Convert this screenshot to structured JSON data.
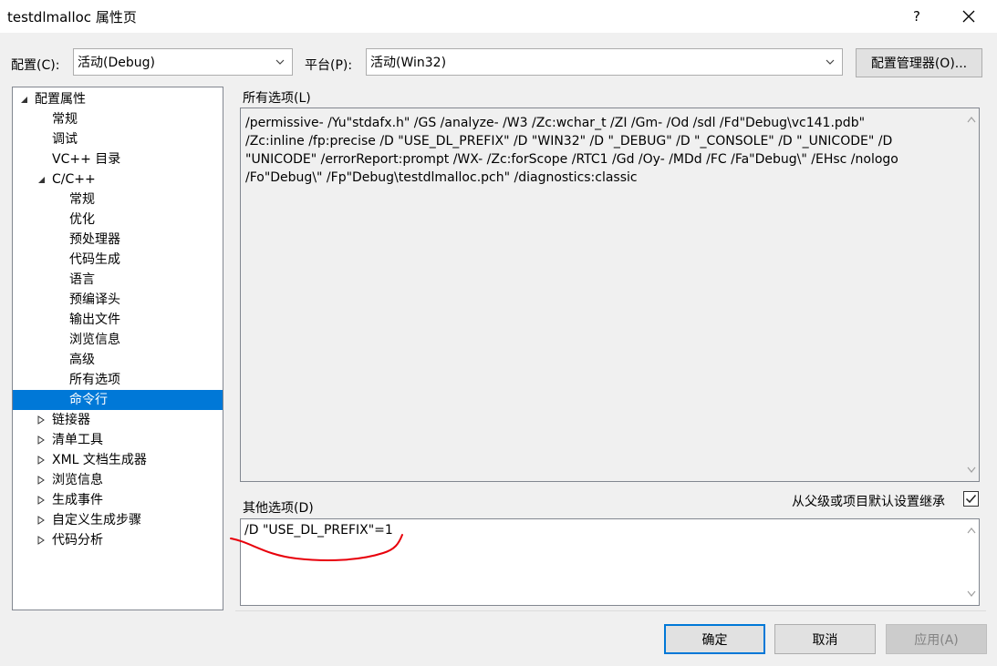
{
  "window": {
    "title": "testdlmalloc 属性页",
    "help_label": "?"
  },
  "toolbar": {
    "config_label": "配置(C):",
    "config_value": "活动(Debug)",
    "platform_label": "平台(P):",
    "platform_value": "活动(Win32)",
    "config_manager_label": "配置管理器(O)..."
  },
  "tree": {
    "items": [
      {
        "label": "配置属性"
      },
      {
        "label": "常规"
      },
      {
        "label": "调试"
      },
      {
        "label": "VC++ 目录"
      },
      {
        "label": "C/C++"
      },
      {
        "label": "常规"
      },
      {
        "label": "优化"
      },
      {
        "label": "预处理器"
      },
      {
        "label": "代码生成"
      },
      {
        "label": "语言"
      },
      {
        "label": "预编译头"
      },
      {
        "label": "输出文件"
      },
      {
        "label": "浏览信息"
      },
      {
        "label": "高级"
      },
      {
        "label": "所有选项"
      },
      {
        "label": "命令行"
      },
      {
        "label": "链接器"
      },
      {
        "label": "清单工具"
      },
      {
        "label": "XML 文档生成器"
      },
      {
        "label": "浏览信息"
      },
      {
        "label": "生成事件"
      },
      {
        "label": "自定义生成步骤"
      },
      {
        "label": "代码分析"
      }
    ]
  },
  "all_options": {
    "label": "所有选项(L)",
    "lines": [
      "/permissive- /Yu\"stdafx.h\" /GS /analyze- /W3 /Zc:wchar_t /ZI /Gm- /Od /sdl /Fd\"Debug\\vc141.pdb\"",
      "/Zc:inline /fp:precise /D \"USE_DL_PREFIX\" /D \"WIN32\" /D \"_DEBUG\" /D \"_CONSOLE\" /D \"_UNICODE\" /D",
      "\"UNICODE\" /errorReport:prompt /WX- /Zc:forScope /RTC1 /Gd /Oy- /MDd /FC /Fa\"Debug\\\" /EHsc /nologo",
      "/Fo\"Debug\\\" /Fp\"Debug\\testdlmalloc.pch\" /diagnostics:classic"
    ]
  },
  "other_options": {
    "label": "其他选项(D)",
    "value": "/D \"USE_DL_PREFIX\"=1",
    "inherit_label": "从父级或项目默认设置继承",
    "inherit_checked": true
  },
  "footer": {
    "ok_label": "确定",
    "cancel_label": "取消",
    "apply_label": "应用(A)"
  },
  "colors": {
    "accent": "#0078d7",
    "annotation": "#e8000b"
  }
}
